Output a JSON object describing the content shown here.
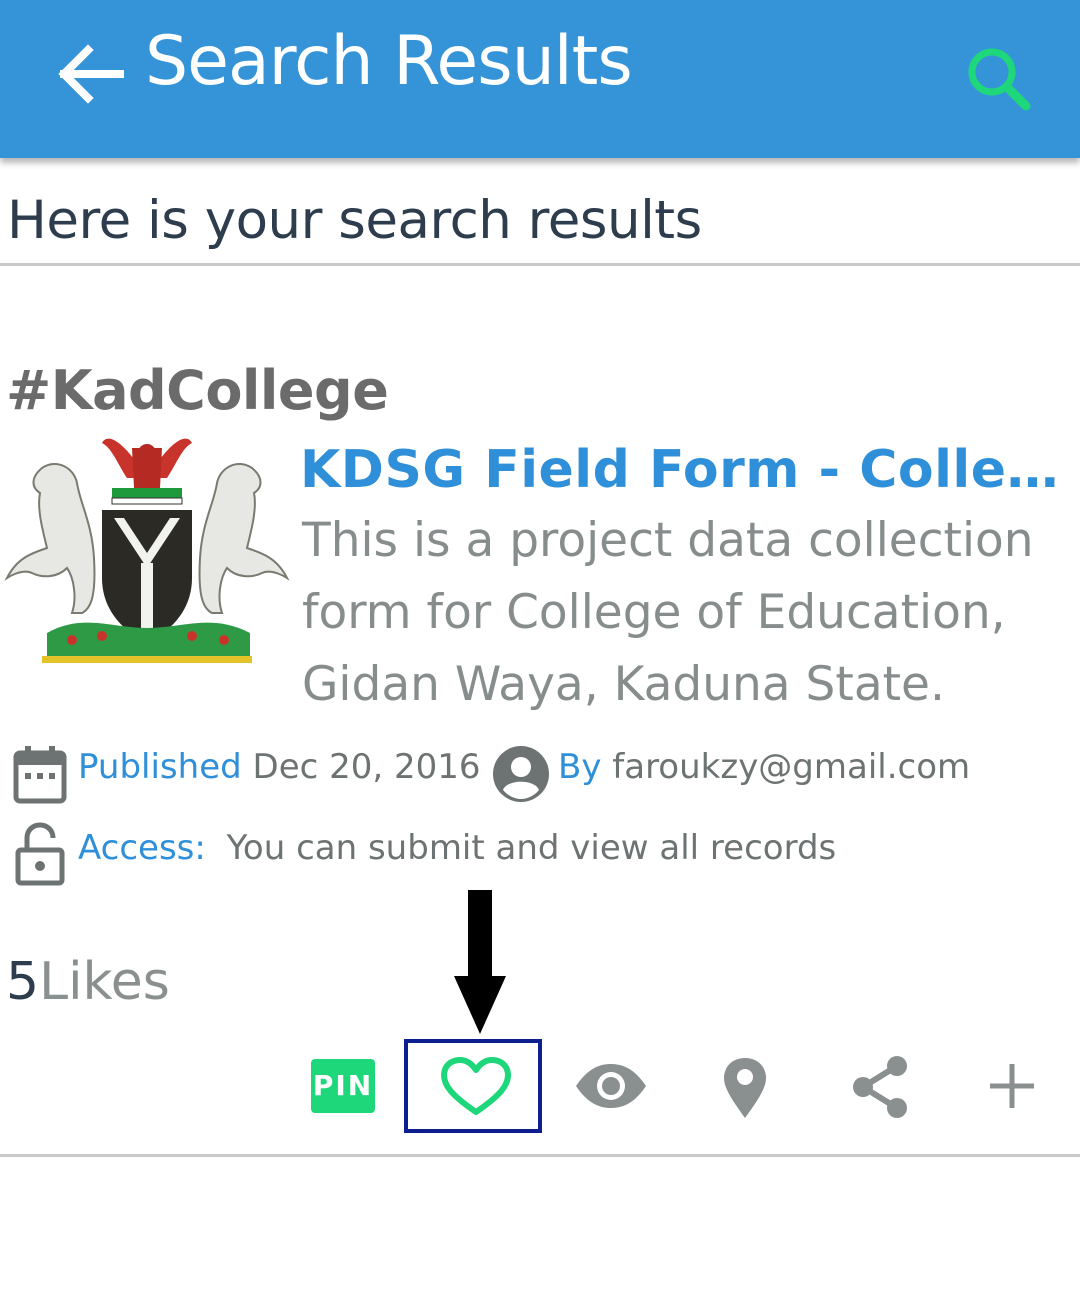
{
  "appbar": {
    "title": "Search Results",
    "back_icon": "arrow-left-icon",
    "search_icon": "search-icon",
    "color": "#3594d8",
    "search_color": "#1ed77a"
  },
  "subheader": {
    "text": "Here is your search results"
  },
  "result": {
    "hashtag": "#KadCollege",
    "logo_icon": "coat-of-arms-logo",
    "title": "KDSG Field Form - Colleg...",
    "description": "This is a project data collection form for College of Education, Gidan Waya, Kaduna State.",
    "published_label": "Published",
    "published_date": "Dec 20, 2016",
    "author_label": "By",
    "author": "faroukzy@gmail.com",
    "access_label": "Access:",
    "access_text": "You can submit and view all records",
    "likes_count": "5",
    "likes_label": "Likes",
    "actions": {
      "pin_label": "PIN",
      "icons": [
        "heart-icon",
        "eye-icon",
        "map-pin-icon",
        "share-icon",
        "plus-icon"
      ]
    }
  },
  "colors": {
    "accent": "#2f8fd8",
    "like": "#1ed77a",
    "highlight": "#0d1f8f"
  }
}
